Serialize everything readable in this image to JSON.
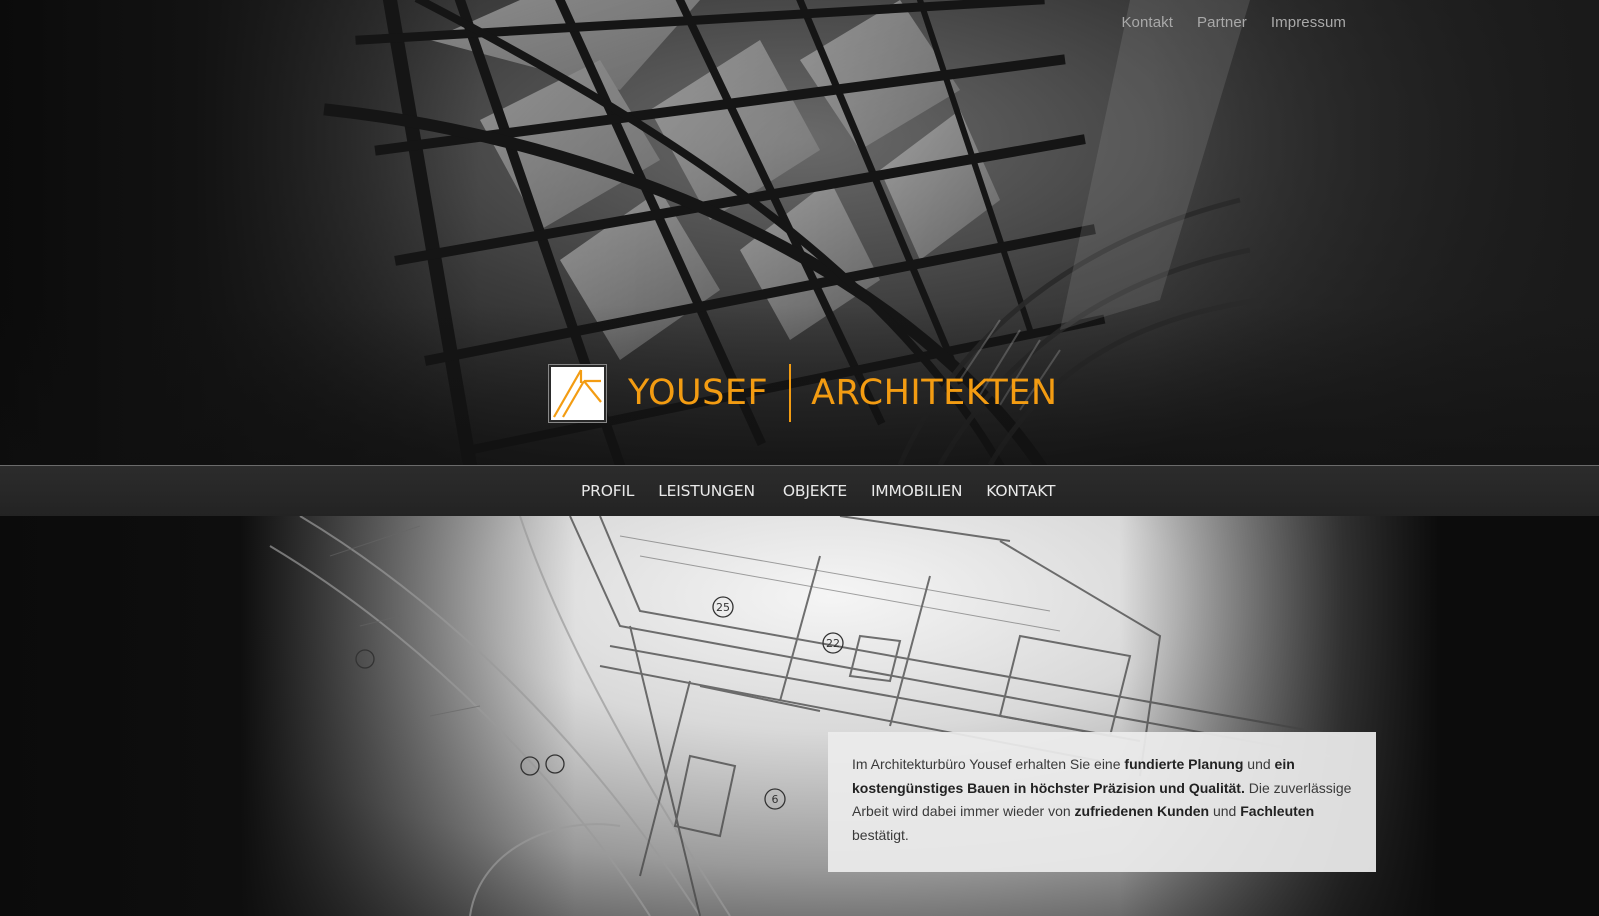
{
  "top_links": [
    "Kontakt",
    "Partner",
    "Impressum"
  ],
  "logo": {
    "first_word": "YOUSEF",
    "second_word": "ARCHITEKTEN"
  },
  "nav": [
    "PROFIL",
    "LEISTUNGEN",
    "OBJEKTE",
    "IMMOBILIEN",
    "KONTAKT"
  ],
  "intro": {
    "p1": "Im Architekturbüro Yousef erhalten Sie eine ",
    "b1": "fundierte Planung",
    "p2": " und ",
    "b2": "ein kostengünstiges Bauen in höchster Präzision und Qualität.",
    "p3": " Die zuverlässige Arbeit wird dabei immer wieder von ",
    "b3": "zufriedenen Kunden",
    "p4": " und ",
    "b4": "Fachleuten",
    "p5": " bestätigt."
  },
  "colors": {
    "accent": "#f39c12",
    "nav_bg": "#262626",
    "background": "#0c0c0c"
  },
  "icons": {
    "logo_mark": "square-with-diagonal-lines-logo"
  }
}
